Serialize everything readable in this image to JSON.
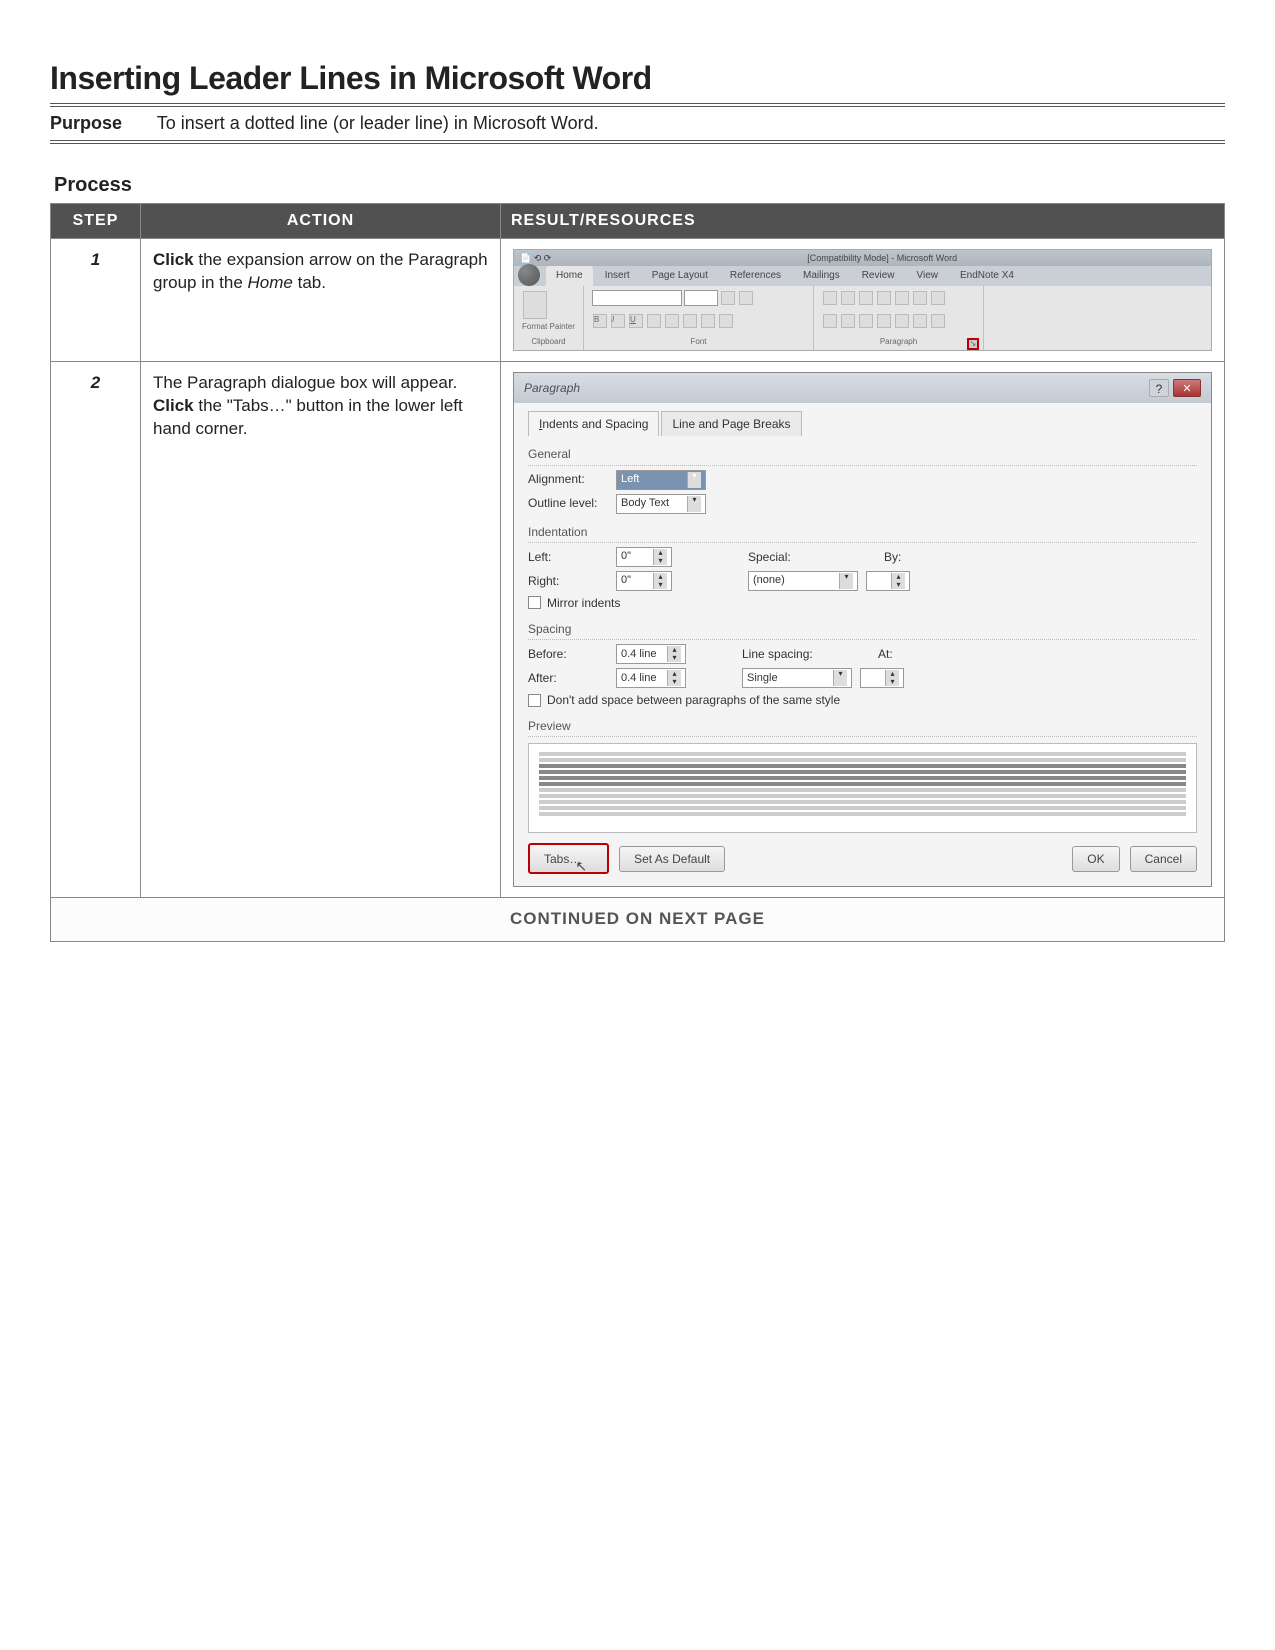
{
  "title": "Inserting Leader Lines in Microsoft Word",
  "purpose": {
    "label": "Purpose",
    "text": "To insert a dotted line (or leader line) in Microsoft Word."
  },
  "process_heading": "Process",
  "columns": {
    "step": "STEP",
    "action": "ACTION",
    "result": "RESULT/RESOURCES"
  },
  "steps": [
    {
      "num": "1",
      "action_parts": {
        "bold": "Click",
        "rest": " the expansion arrow on the Paragraph group in the ",
        "italic": "Home",
        "tail": " tab."
      }
    },
    {
      "num": "2",
      "action_parts": {
        "line1": "The Paragraph dialogue box will appear.",
        "bold": "Click",
        "rest": " the \"Tabs…\" button in the lower left hand corner."
      }
    }
  ],
  "continued": "CONTINUED ON NEXT PAGE",
  "ribbon": {
    "title_suffix": "[Compatibility Mode] - Microsoft Word",
    "tabs": [
      "Home",
      "Insert",
      "Page Layout",
      "References",
      "Mailings",
      "Review",
      "View",
      "EndNote X4"
    ],
    "groups": {
      "clipboard": "Clipboard",
      "format_painter": "Format Painter",
      "font": "Font",
      "paragraph": "Paragraph"
    }
  },
  "dialog": {
    "title": "Paragraph",
    "tabs": {
      "t1": "Indents and Spacing",
      "t2": "Line and Page Breaks"
    },
    "general": {
      "heading": "General",
      "alignment_label": "Alignment:",
      "alignment_value": "Left",
      "outline_label": "Outline level:",
      "outline_value": "Body Text"
    },
    "indent": {
      "heading": "Indentation",
      "left_label": "Left:",
      "left_value": "0\"",
      "right_label": "Right:",
      "right_value": "0\"",
      "special_label": "Special:",
      "special_value": "(none)",
      "by_label": "By:",
      "mirror": "Mirror indents"
    },
    "spacing": {
      "heading": "Spacing",
      "before_label": "Before:",
      "before_value": "0.4 line",
      "after_label": "After:",
      "after_value": "0.4 line",
      "linespacing_label": "Line spacing:",
      "linespacing_value": "Single",
      "at_label": "At:",
      "no_space": "Don't add space between paragraphs of the same style"
    },
    "preview_heading": "Preview",
    "buttons": {
      "tabs": "Tabs…",
      "default": "Set As Default",
      "ok": "OK",
      "cancel": "Cancel"
    }
  }
}
